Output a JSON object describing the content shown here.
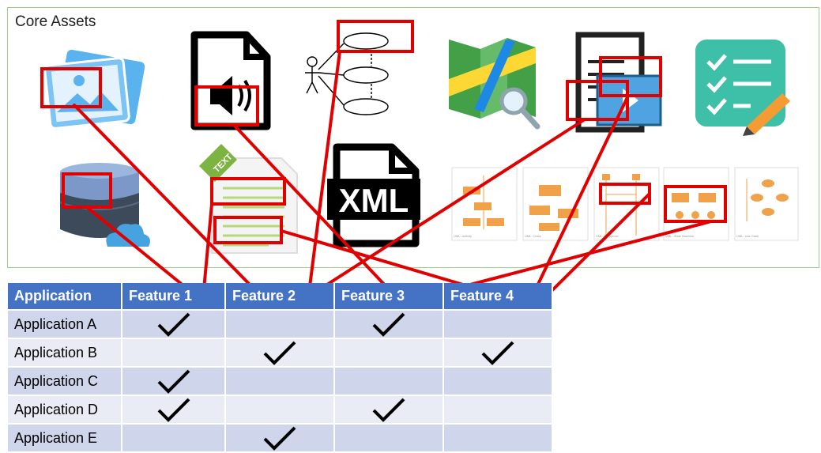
{
  "panel": {
    "title": "Core Assets"
  },
  "asset_icons": [
    "photo-gallery-icon",
    "audio-file-icon",
    "use-case-diagram-icon",
    "map-search-icon",
    "document-video-icon",
    "checklist-edit-icon",
    "cloud-database-icon",
    "text-file-icon",
    "xml-file-icon",
    "uml-diagrams-icon"
  ],
  "xml_label": "XML",
  "text_label": "TEXT",
  "uml_captions": [
    "UML: Activity",
    "UML: Class",
    "UML: Sequence",
    "UML: State Machine",
    "UML: Use Case"
  ],
  "table": {
    "headers": [
      "Application",
      "Feature 1",
      "Feature 2",
      "Feature 3",
      "Feature 4"
    ],
    "rows": [
      {
        "name": "Application A",
        "checks": [
          true,
          false,
          true,
          false
        ]
      },
      {
        "name": "Application B",
        "checks": [
          false,
          true,
          false,
          true
        ]
      },
      {
        "name": "Application C",
        "checks": [
          true,
          false,
          false,
          false
        ]
      },
      {
        "name": "Application D",
        "checks": [
          true,
          false,
          true,
          false
        ]
      },
      {
        "name": "Application E",
        "checks": [
          false,
          true,
          false,
          false
        ]
      }
    ]
  },
  "colors": {
    "highlight": "#e00000",
    "header": "#4472c4",
    "row_odd": "#cfd5ea",
    "row_even": "#e9ebf5",
    "panel_border": "#9bcf86"
  }
}
